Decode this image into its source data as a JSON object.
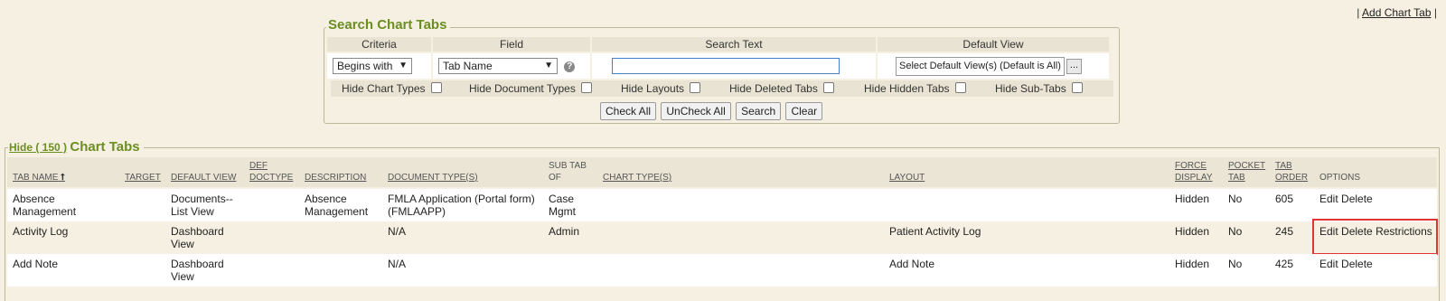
{
  "top": {
    "separator_left": "|",
    "add_chart_tab": "Add Chart Tab",
    "separator_right": "|"
  },
  "search": {
    "legend": "Search Chart Tabs",
    "headers": [
      "Criteria",
      "Field",
      "Search Text",
      "Default View"
    ],
    "criteria_value": "Begins with",
    "field_value": "Tab Name",
    "help_icon": "?",
    "search_text_value": "",
    "default_view_value": "Select Default View(s) (Default is All)",
    "default_view_button": "...",
    "hide_options": [
      "Hide Chart Types",
      "Hide Document Types",
      "Hide Layouts",
      "Hide Deleted Tabs",
      "Hide Hidden Tabs",
      "Hide Sub-Tabs"
    ],
    "buttons": [
      "Check All",
      "UnCheck All",
      "Search",
      "Clear"
    ]
  },
  "tabs": {
    "hide_link": "Hide ( 150 )",
    "title": "Chart Tabs",
    "columns": {
      "tab_name": "TAB NAME",
      "sort_icon": "⭡",
      "target": "TARGET",
      "default_view": "DEFAULT VIEW",
      "def_doctype_1": "DEF",
      "def_doctype_2": "DOCTYPE",
      "description": "DESCRIPTION",
      "document_types": "DOCUMENT TYPE(S)",
      "sub_tab_of_1": "SUB TAB",
      "sub_tab_of_2": "OF",
      "chart_types": "CHART TYPE(S)",
      "layout": "LAYOUT",
      "force_display_1": "FORCE",
      "force_display_2": "DISPLAY",
      "pocket_tab_1": "POCKET",
      "pocket_tab_2": "TAB",
      "tab_order_1": "TAB",
      "tab_order_2": "ORDER",
      "options": "OPTIONS"
    },
    "rows": [
      {
        "tab_name_1": "Absence",
        "tab_name_2": "Management",
        "default_view_1": "Documents--",
        "default_view_2": "List View",
        "description_1": "Absence",
        "description_2": "Management",
        "document_types_1": "FMLA Application (Portal form)",
        "document_types_2": "(FMLAAPP)",
        "sub_tab_of_1": "Case",
        "sub_tab_of_2": "Mgmt",
        "layout": "",
        "force_display": "Hidden",
        "pocket_tab": "No",
        "tab_order": "605",
        "options": [
          "Edit",
          "Delete"
        ]
      },
      {
        "tab_name_1": "Activity Log",
        "tab_name_2": "",
        "default_view_1": "Dashboard",
        "default_view_2": "View",
        "description_1": "",
        "description_2": "",
        "document_types_1": "N/A",
        "document_types_2": "",
        "sub_tab_of_1": "Admin",
        "sub_tab_of_2": "",
        "layout": "Patient Activity Log",
        "force_display": "Hidden",
        "pocket_tab": "No",
        "tab_order": "245",
        "options": [
          "Edit",
          "Delete",
          "Restrictions"
        ]
      },
      {
        "tab_name_1": "Add Note",
        "tab_name_2": "",
        "default_view_1": "Dashboard",
        "default_view_2": "View",
        "description_1": "",
        "description_2": "",
        "document_types_1": "N/A",
        "document_types_2": "",
        "sub_tab_of_1": "",
        "sub_tab_of_2": "",
        "layout": "Add Note",
        "force_display": "Hidden",
        "pocket_tab": "No",
        "tab_order": "425",
        "options": [
          "Edit",
          "Delete"
        ]
      }
    ]
  },
  "colors": {
    "accent_green": "#6b8e23",
    "background": "#f6f0e2",
    "highlight_red": "#e03535"
  }
}
